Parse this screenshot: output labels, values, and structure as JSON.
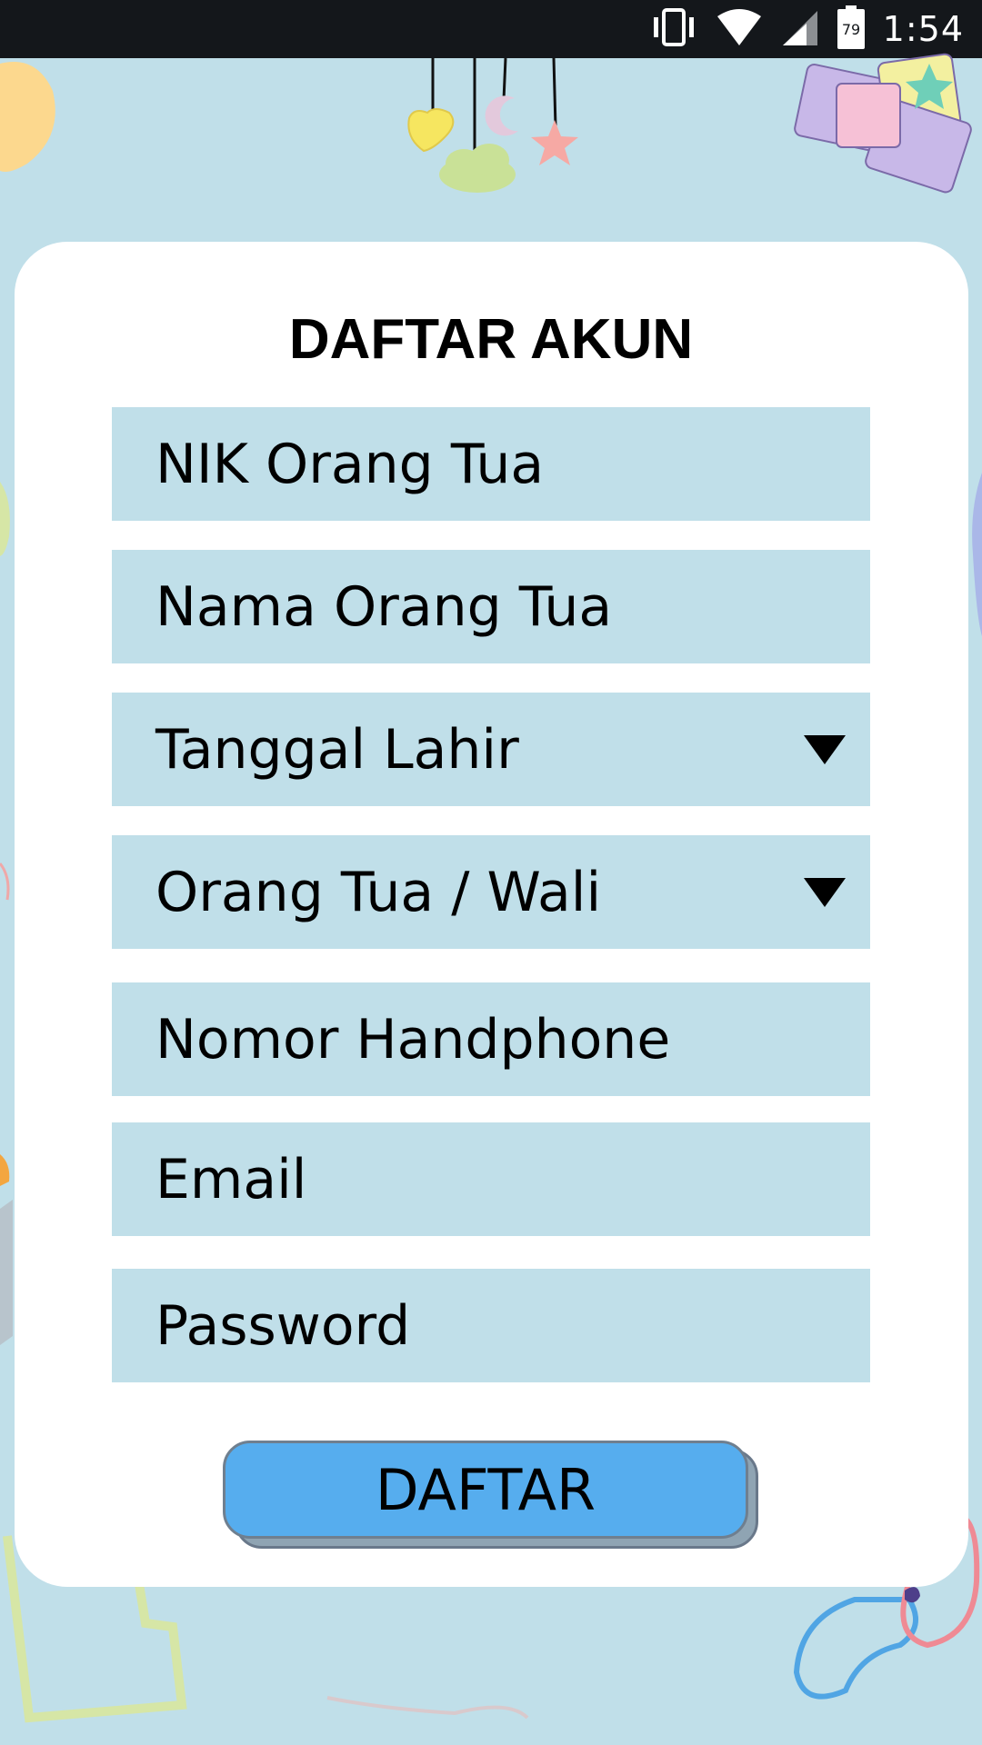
{
  "status_bar": {
    "time": "1:54",
    "battery_level": "79",
    "icons": [
      "vibrate-icon",
      "wifi-icon",
      "cell-signal-icon",
      "battery-icon"
    ]
  },
  "form": {
    "title": "DAFTAR AKUN",
    "fields": [
      {
        "name": "nik-orang-tua-field",
        "placeholder": "NIK Orang Tua",
        "dropdown": false
      },
      {
        "name": "nama-orang-tua-field",
        "placeholder": "Nama Orang Tua",
        "dropdown": false
      },
      {
        "name": "tanggal-lahir-select",
        "placeholder": "Tanggal Lahir",
        "dropdown": true
      },
      {
        "name": "orang-tua-wali-select",
        "placeholder": "Orang Tua / Wali",
        "dropdown": true
      },
      {
        "name": "nomor-handphone-field",
        "placeholder": "Nomor Handphone",
        "dropdown": false
      },
      {
        "name": "email-field",
        "placeholder": "Email",
        "dropdown": false
      },
      {
        "name": "password-field",
        "placeholder": "Password",
        "dropdown": false
      }
    ],
    "submit_label": "DAFTAR"
  },
  "colors": {
    "background": "#c0dfe9",
    "card": "#ffffff",
    "field": "#c0dfe9",
    "button": "#56adee",
    "status_bar": "#14171b"
  }
}
